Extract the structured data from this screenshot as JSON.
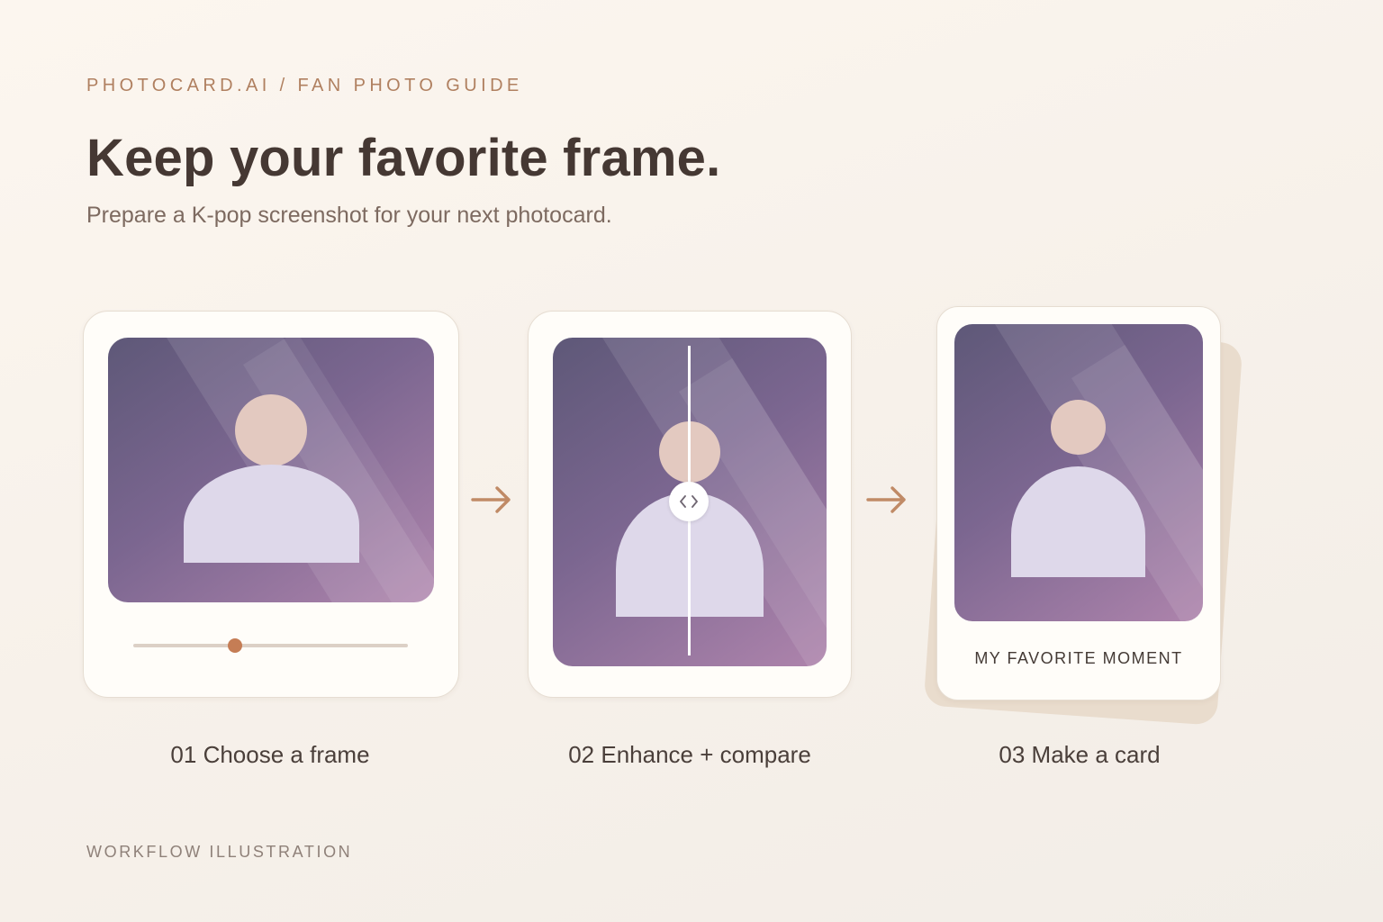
{
  "header": {
    "eyebrow": "PHOTOCARD.AI / FAN PHOTO GUIDE",
    "title": "Keep your favorite frame.",
    "subtitle": "Prepare a K-pop screenshot for your next photocard."
  },
  "steps": [
    {
      "label": "01 Choose a frame",
      "slider_position": 0.37
    },
    {
      "label": "02 Enhance + compare"
    },
    {
      "label": "03 Make a card",
      "card_caption": "MY FAVORITE MOMENT"
    }
  ],
  "footer": {
    "text": "WORKFLOW ILLUSTRATION"
  },
  "icons": [
    "arrow-right-icon",
    "compare-handle-icon"
  ],
  "colors": {
    "accent": "#c57d55",
    "title": "#453833",
    "eyebrow": "#b08060",
    "photo_start": "#5e5878",
    "photo_end": "#ae84ac"
  }
}
